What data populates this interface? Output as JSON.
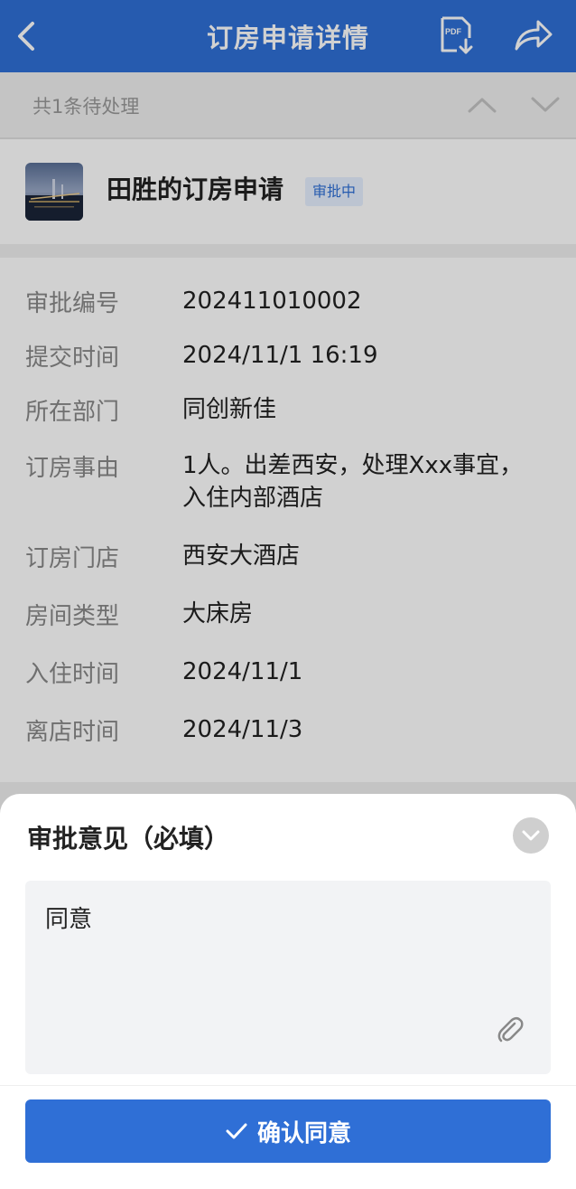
{
  "header": {
    "title": "订房申请详情"
  },
  "pending": {
    "text": "共1条待处理"
  },
  "application": {
    "title": "田胜的订房申请",
    "status": "审批中"
  },
  "details": [
    {
      "label": "审批编号",
      "value": "202411010002"
    },
    {
      "label": "提交时间",
      "value": "2024/11/1 16:19"
    },
    {
      "label": "所在部门",
      "value": "同创新佳"
    },
    {
      "label": "订房事由",
      "value": "1人。出差西安，处理Xxx事宜，",
      "value2": "入住内部酒店"
    },
    {
      "label": "订房门店",
      "value": "西安大酒店"
    },
    {
      "label": "房间类型",
      "value": "大床房"
    },
    {
      "label": "入住时间",
      "value": "2024/11/1"
    },
    {
      "label": "离店时间",
      "value": "2024/11/3"
    }
  ],
  "sheet": {
    "heading": "审批意见（必填）",
    "comment": "同意",
    "confirm_label": "确认同意"
  },
  "colors": {
    "primary": "#2f6fd6",
    "badge_bg": "#e6efff"
  }
}
